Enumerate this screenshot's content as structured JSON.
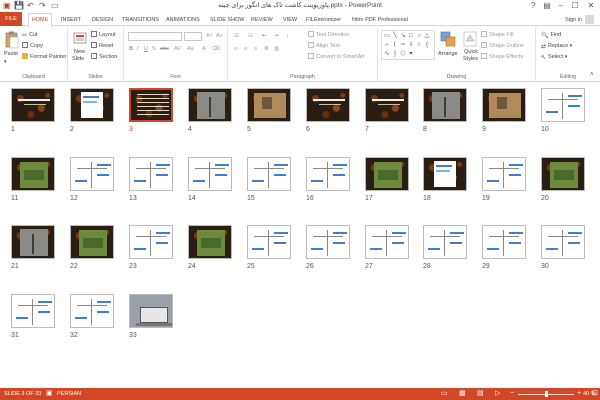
{
  "titlebar": {
    "title": "پاورپوینت کاشت تاک های انگور برای چینه.pptx - PowerPoint",
    "qat": [
      "save-icon",
      "undo-icon",
      "redo-icon",
      "slideshow-icon"
    ]
  },
  "tabs": {
    "file": "FILE",
    "items": [
      "HOME",
      "INSERT",
      "DESIGN",
      "TRANSITIONS",
      "ANIMATIONS",
      "SLIDE SHOW",
      "REVIEW",
      "VIEW",
      "FILEminimizer",
      "Nitro PDF Professional"
    ],
    "signin": "Sign in"
  },
  "ribbon": {
    "clipboard": {
      "paste": "Paste",
      "cut": "Cut",
      "copy": "Copy",
      "format_painter": "Format Painter",
      "label": "Clipboard"
    },
    "slides": {
      "new_slide_line1": "New",
      "new_slide_line2": "Slide",
      "layout": "Layout",
      "reset": "Reset",
      "section": "Section",
      "label": "Slides"
    },
    "font": {
      "label": "Font"
    },
    "paragraph": {
      "text_direction": "Text Direction",
      "align_text": "Align Text",
      "convert_smartart": "Convert to SmartArt",
      "label": "Paragraph"
    },
    "drawing": {
      "arrange": "Arrange",
      "quick_styles_line1": "Quick",
      "quick_styles_line2": "Styles",
      "shape_fill": "Shape Fill",
      "shape_outline": "Shape Outline",
      "shape_effects": "Shape Effects",
      "label": "Drawing"
    },
    "editing": {
      "find": "Find",
      "replace": "Replace",
      "select": "Select",
      "label": "Editing"
    }
  },
  "slides": {
    "selected": 3,
    "items": [
      {
        "n": "1",
        "kind": "dark"
      },
      {
        "n": "2",
        "kind": "dark-doc"
      },
      {
        "n": "3",
        "kind": "dark-text"
      },
      {
        "n": "4",
        "kind": "dark-photo"
      },
      {
        "n": "5",
        "kind": "dark-photo2"
      },
      {
        "n": "6",
        "kind": "dark"
      },
      {
        "n": "7",
        "kind": "dark"
      },
      {
        "n": "8",
        "kind": "dark-photo"
      },
      {
        "n": "9",
        "kind": "dark-photo2"
      },
      {
        "n": "10",
        "kind": "light-diagram"
      },
      {
        "n": "11",
        "kind": "dark-green"
      },
      {
        "n": "12",
        "kind": "light-diagram"
      },
      {
        "n": "13",
        "kind": "light-diagram"
      },
      {
        "n": "14",
        "kind": "light-diagram"
      },
      {
        "n": "15",
        "kind": "light-diagram"
      },
      {
        "n": "16",
        "kind": "light-diagram"
      },
      {
        "n": "17",
        "kind": "dark-green"
      },
      {
        "n": "18",
        "kind": "dark-doc"
      },
      {
        "n": "19",
        "kind": "light-diagram"
      },
      {
        "n": "20",
        "kind": "dark-green"
      },
      {
        "n": "21",
        "kind": "dark-photo"
      },
      {
        "n": "22",
        "kind": "dark-green"
      },
      {
        "n": "23",
        "kind": "light-diagram"
      },
      {
        "n": "24",
        "kind": "dark-green"
      },
      {
        "n": "25",
        "kind": "light-diagram"
      },
      {
        "n": "26",
        "kind": "light-diagram"
      },
      {
        "n": "27",
        "kind": "light-diagram"
      },
      {
        "n": "28",
        "kind": "light-diagram"
      },
      {
        "n": "29",
        "kind": "light-diagram"
      },
      {
        "n": "30",
        "kind": "light-diagram"
      },
      {
        "n": "31",
        "kind": "light-diagram"
      },
      {
        "n": "32",
        "kind": "light-diagram"
      },
      {
        "n": "33",
        "kind": "photo"
      }
    ]
  },
  "statusbar": {
    "slide_info": "SLIDE 3 OF 33",
    "language": "PERSIAN",
    "zoom": "40 %",
    "zoom_fraction": 0.5
  },
  "colors": {
    "accent": "#d24726",
    "selection": "#d24726",
    "diagram_blue": "#3f7fd0"
  }
}
